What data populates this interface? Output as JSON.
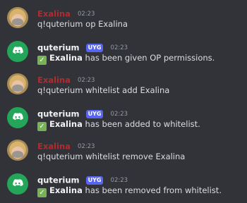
{
  "messages": [
    {
      "type": "user",
      "author": "Exalina",
      "time": "02:23",
      "text": "q!quterium op Exalina"
    },
    {
      "type": "bot",
      "author": "quterium",
      "tag": "UYG",
      "time": "02:23",
      "emoji": "✓",
      "subject": "Exalina",
      "text": " has been given OP permissions."
    },
    {
      "type": "user",
      "author": "Exalina",
      "time": "02:23",
      "text": "q!quterium whitelist add Exalina"
    },
    {
      "type": "bot",
      "author": "quterium",
      "tag": "UYG",
      "time": "02:23",
      "emoji": "✓",
      "subject": "Exalina",
      "text": " has been added to whitelist."
    },
    {
      "type": "user",
      "author": "Exalina",
      "time": "02:23",
      "text": "q!quterium whitelist remove Exalina"
    },
    {
      "type": "bot",
      "author": "quterium",
      "tag": "UYG",
      "time": "02:23",
      "emoji": "✓",
      "subject": "Exalina",
      "text": " has been removed from whitelist."
    }
  ],
  "theme": {
    "background": "#313338",
    "user_name_color": "#b32b2f",
    "bot_name_color": "#f2f3f5",
    "tag_color": "#5865f2",
    "bot_avatar_color": "#23a55a",
    "check_color": "#77b255"
  },
  "icons": {
    "user_avatar": "user-avatar",
    "bot_avatar": "discord-logo-icon",
    "check": "check-mark-icon"
  }
}
